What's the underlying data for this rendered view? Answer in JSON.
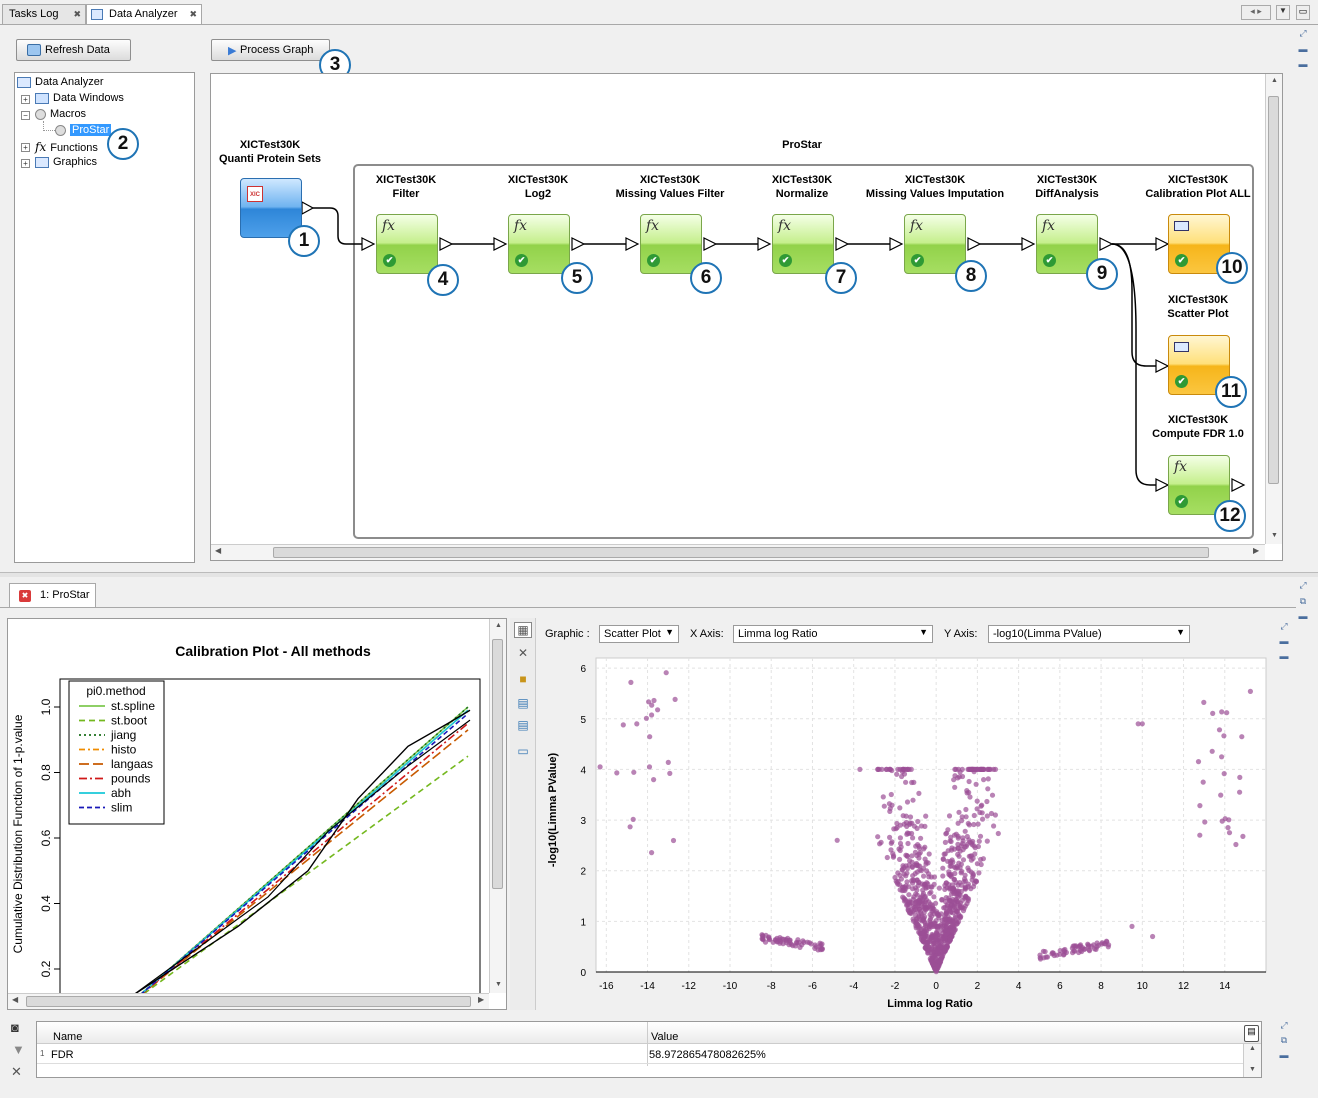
{
  "tabs": [
    {
      "label": "Tasks Log"
    },
    {
      "label": "Data Analyzer"
    }
  ],
  "left": {
    "refresh_label": "Refresh Data",
    "tree": {
      "root": "Data Analyzer",
      "items": [
        "Data Windows",
        "Macros",
        "ProStar",
        "Functions",
        "Graphics"
      ],
      "fx_glyph": "fx"
    }
  },
  "graph": {
    "process_label": "Process Graph",
    "group_title": "ProStar",
    "nodes": [
      {
        "num": "1",
        "line1": "XICTest30K",
        "line2": "Quanti Protein Sets"
      },
      {
        "num": "4",
        "line1": "XICTest30K",
        "line2": "Filter"
      },
      {
        "num": "5",
        "line1": "XICTest30K",
        "line2": "Log2"
      },
      {
        "num": "6",
        "line1": "XICTest30K",
        "line2": "Missing Values Filter"
      },
      {
        "num": "7",
        "line1": "XICTest30K",
        "line2": "Normalize"
      },
      {
        "num": "8",
        "line1": "XICTest30K",
        "line2": "Missing Values Imputation"
      },
      {
        "num": "9",
        "line1": "XICTest30K",
        "line2": "DiffAnalysis"
      },
      {
        "num": "10",
        "line1": "XICTest30K",
        "line2": "Calibration Plot ALL"
      },
      {
        "num": "11",
        "line1": "XICTest30K",
        "line2": "Scatter Plot"
      },
      {
        "num": "12",
        "line1": "XICTest30K",
        "line2": "Compute FDR 1.0"
      }
    ],
    "fx": "fx",
    "check": "✔",
    "xic": "XIC",
    "callouts": {
      "c2": "2",
      "c3": "3"
    }
  },
  "bottom_tab": {
    "label": "1: ProStar"
  },
  "calib": {
    "title": "Calibration Plot - All methods",
    "ylabel": "Cumulative Distribution Function of 1-p.value",
    "legend_title": "pi0.method",
    "legend": [
      {
        "name": "st.spline",
        "color": "#7ec850"
      },
      {
        "name": "st.boot",
        "color": "#74b81e"
      },
      {
        "name": "jiang",
        "color": "#1a6e1a"
      },
      {
        "name": "histo",
        "color": "#f08c00"
      },
      {
        "name": "langaas",
        "color": "#c85a00"
      },
      {
        "name": "pounds",
        "color": "#d01818"
      },
      {
        "name": "abh",
        "color": "#18c8d8"
      },
      {
        "name": "slim",
        "color": "#1818b8"
      }
    ],
    "yticks": [
      "0.2",
      "0.4",
      "0.6",
      "0.8",
      "1.0"
    ]
  },
  "scatter": {
    "graphic_label": "Graphic :",
    "graphic_value": "Scatter Plot",
    "x_label": "X Axis:",
    "x_value": "Limma log Ratio",
    "y_label": "Y Axis:",
    "y_value": "-log10(Limma PValue)",
    "chart_data": {
      "type": "scatter",
      "xlabel": "Limma log Ratio",
      "ylabel": "-log10(Limma PValue)",
      "xlim": [
        -16.5,
        16
      ],
      "ylim": [
        0,
        6.2
      ],
      "xticks": [
        -16,
        -14,
        -12,
        -10,
        -8,
        -6,
        -4,
        -2,
        0,
        2,
        4,
        6,
        8,
        10,
        12,
        14
      ],
      "yticks": [
        0,
        1,
        2,
        3,
        4,
        5,
        6
      ],
      "point_color": "#9b4f96"
    }
  },
  "table": {
    "headers": [
      "Name",
      "Value"
    ],
    "rows": [
      {
        "idx": "1",
        "name": "FDR",
        "value": "58.972865478082625%"
      }
    ]
  }
}
